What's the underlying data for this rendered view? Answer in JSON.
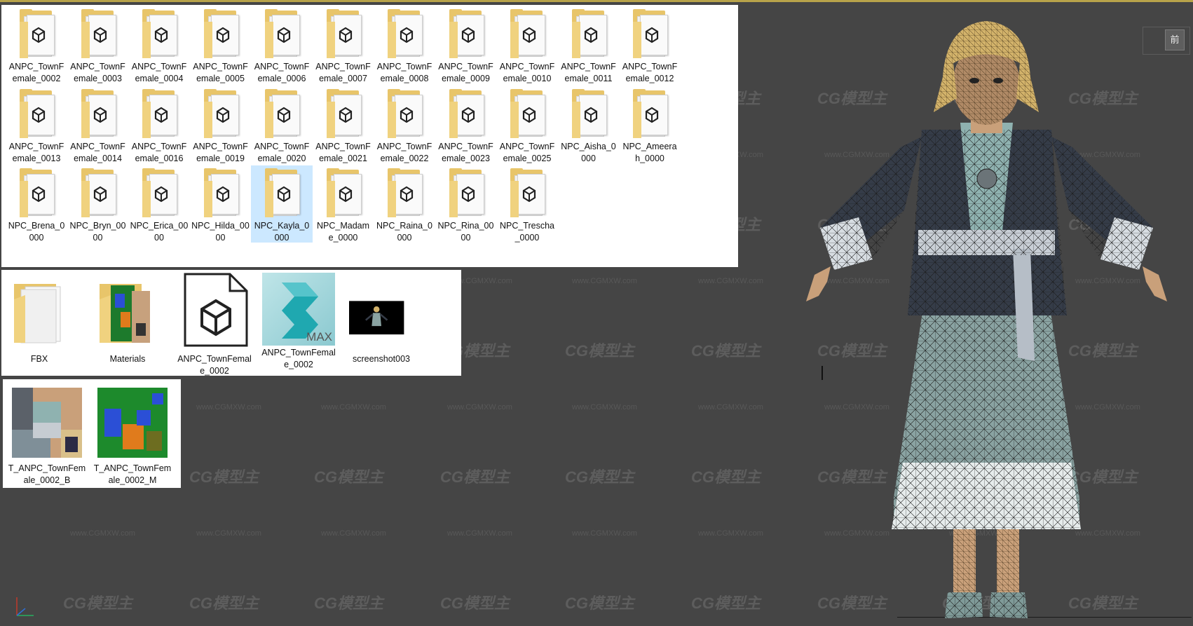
{
  "explorer_row1": [
    {
      "name": "ANPC_TownFemale_0002",
      "l1": "ANPC_TownF",
      "l2": "emale_0002"
    },
    {
      "name": "ANPC_TownFemale_0003",
      "l1": "ANPC_TownF",
      "l2": "emale_0003"
    },
    {
      "name": "ANPC_TownFemale_0004",
      "l1": "ANPC_TownF",
      "l2": "emale_0004"
    },
    {
      "name": "ANPC_TownFemale_0005",
      "l1": "ANPC_TownF",
      "l2": "emale_0005"
    },
    {
      "name": "ANPC_TownFemale_0006",
      "l1": "ANPC_TownF",
      "l2": "emale_0006"
    },
    {
      "name": "ANPC_TownFemale_0007",
      "l1": "ANPC_TownF",
      "l2": "emale_0007"
    },
    {
      "name": "ANPC_TownFemale_0008",
      "l1": "ANPC_TownF",
      "l2": "emale_0008"
    },
    {
      "name": "ANPC_TownFemale_0009",
      "l1": "ANPC_TownF",
      "l2": "emale_0009"
    },
    {
      "name": "ANPC_TownFemale_0010",
      "l1": "ANPC_TownF",
      "l2": "emale_0010"
    },
    {
      "name": "ANPC_TownFemale_0011",
      "l1": "ANPC_TownF",
      "l2": "emale_0011"
    },
    {
      "name": "ANPC_TownFemale_0012",
      "l1": "ANPC_TownF",
      "l2": "emale_0012"
    }
  ],
  "explorer_row2": [
    {
      "l1": "ANPC_TownF",
      "l2": "emale_0013"
    },
    {
      "l1": "ANPC_TownF",
      "l2": "emale_0014"
    },
    {
      "l1": "ANPC_TownF",
      "l2": "emale_0016"
    },
    {
      "l1": "ANPC_TownF",
      "l2": "emale_0019"
    },
    {
      "l1": "ANPC_TownF",
      "l2": "emale_0020"
    },
    {
      "l1": "ANPC_TownF",
      "l2": "emale_0021"
    },
    {
      "l1": "ANPC_TownF",
      "l2": "emale_0022"
    },
    {
      "l1": "ANPC_TownF",
      "l2": "emale_0023"
    },
    {
      "l1": "ANPC_TownF",
      "l2": "emale_0025"
    },
    {
      "l1": "NPC_Aisha_0",
      "l2": "000"
    },
    {
      "l1": "NPC_Ameera",
      "l2": "h_0000"
    }
  ],
  "explorer_row3": [
    {
      "l1": "NPC_Brena_0",
      "l2": "000",
      "selected": false
    },
    {
      "l1": "NPC_Bryn_00",
      "l2": "00",
      "selected": false
    },
    {
      "l1": "NPC_Erica_00",
      "l2": "00",
      "selected": false
    },
    {
      "l1": "NPC_Hilda_00",
      "l2": "00",
      "selected": false
    },
    {
      "l1": "NPC_Kayla_0",
      "l2": "000",
      "selected": true
    },
    {
      "l1": "NPC_Madam",
      "l2": "e_0000",
      "selected": false
    },
    {
      "l1": "NPC_Raina_0",
      "l2": "000",
      "selected": false
    },
    {
      "l1": "NPC_Rina_00",
      "l2": "00",
      "selected": false
    },
    {
      "l1": "NPC_Trescha",
      "l2": "_0000",
      "selected": false
    }
  ],
  "subfolder_items": [
    {
      "kind": "folder",
      "l1": "FBX",
      "l2": ""
    },
    {
      "kind": "materials",
      "l1": "Materials",
      "l2": ""
    },
    {
      "kind": "fbxfile",
      "l1": "ANPC_TownFemal",
      "l2": "e_0002"
    },
    {
      "kind": "max",
      "l1": "ANPC_TownFemal",
      "l2": "e_0002",
      "badge": "MAX"
    },
    {
      "kind": "screenshot",
      "l1": "screenshot003",
      "l2": ""
    }
  ],
  "texture_items": [
    {
      "l1": "T_ANPC_TownFem",
      "l2": "ale_0002_B"
    },
    {
      "l1": "T_ANPC_TownFem",
      "l2": "ale_0002_M"
    }
  ],
  "viewport": {
    "label": "前",
    "watermark": "CG模型主",
    "watermark_url": "www.CGMXW.com"
  },
  "colors": {
    "viewport_bg": "#454545",
    "folder": "#e8c56a",
    "selection": "#cce8ff",
    "max_teal": "#1fa8b0"
  }
}
